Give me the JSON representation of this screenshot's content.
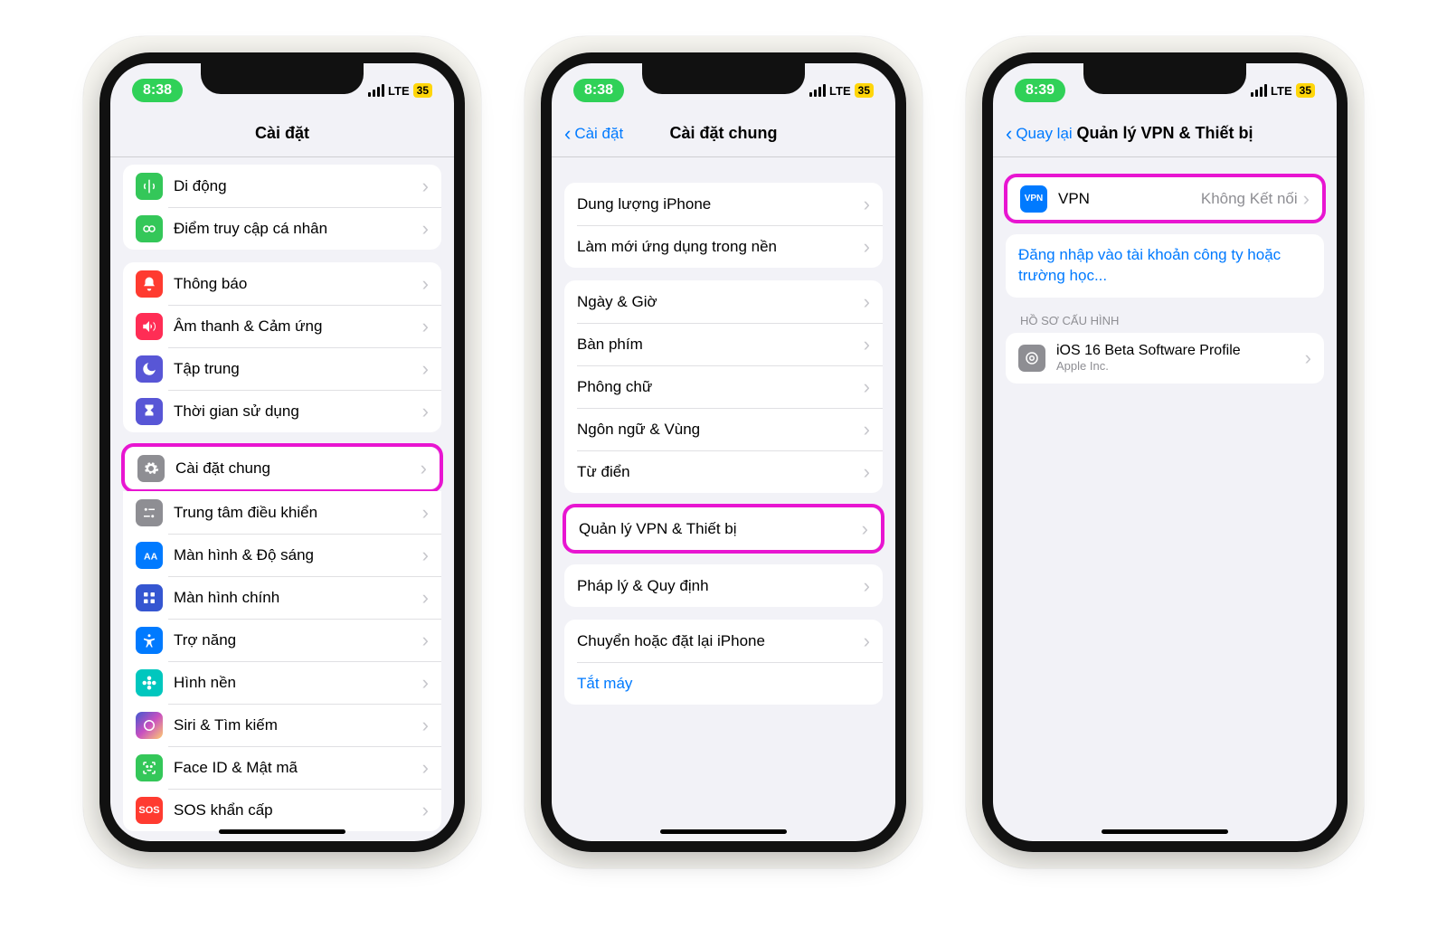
{
  "status": {
    "time1": "8:38",
    "time2": "8:38",
    "time3": "8:39",
    "lte": "LTE",
    "battery": "35"
  },
  "phone1": {
    "title": "Cài đặt",
    "g1": [
      {
        "icon": "cell",
        "label": "Di động"
      },
      {
        "icon": "hot",
        "label": "Điểm truy cập cá nhân"
      }
    ],
    "g2": [
      {
        "icon": "notif",
        "label": "Thông báo"
      },
      {
        "icon": "sound",
        "label": "Âm thanh & Cảm ứng"
      },
      {
        "icon": "focus",
        "label": "Tập trung"
      },
      {
        "icon": "screentime",
        "label": "Thời gian sử dụng"
      }
    ],
    "highlight": {
      "icon": "general",
      "label": "Cài đặt chung"
    },
    "g3": [
      {
        "icon": "control",
        "label": "Trung tâm điều khiển"
      },
      {
        "icon": "display",
        "label": "Màn hình & Độ sáng"
      },
      {
        "icon": "home",
        "label": "Màn hình chính"
      },
      {
        "icon": "access",
        "label": "Trợ năng"
      },
      {
        "icon": "wall",
        "label": "Hình nền"
      },
      {
        "icon": "siri",
        "label": "Siri & Tìm kiếm"
      },
      {
        "icon": "face",
        "label": "Face ID & Mật mã"
      },
      {
        "icon": "sos",
        "label": "SOS khẩn cấp"
      }
    ]
  },
  "phone2": {
    "back": "Cài đặt",
    "title": "Cài đặt chung",
    "g1": [
      {
        "label": "Dung lượng iPhone"
      },
      {
        "label": "Làm mới ứng dụng trong nền"
      }
    ],
    "g2": [
      {
        "label": "Ngày & Giờ"
      },
      {
        "label": "Bàn phím"
      },
      {
        "label": "Phông chữ"
      },
      {
        "label": "Ngôn ngữ & Vùng"
      },
      {
        "label": "Từ điển"
      }
    ],
    "highlight": {
      "label": "Quản lý VPN & Thiết bị"
    },
    "g3": [
      {
        "label": "Pháp lý & Quy định"
      }
    ],
    "g4": [
      {
        "label": "Chuyển hoặc đặt lại iPhone"
      },
      {
        "label": "Tắt máy",
        "link": true
      }
    ]
  },
  "phone3": {
    "back": "Quay lại",
    "title": "Quản lý VPN & Thiết bị",
    "vpn": {
      "label": "VPN",
      "value": "Không Kết nối"
    },
    "signin": "Đăng nhập vào tài khoản công ty hoặc trường học...",
    "section": "HỒ SƠ CẤU HÌNH",
    "profile": {
      "label": "iOS 16 Beta Software Profile",
      "sub": "Apple Inc."
    }
  }
}
